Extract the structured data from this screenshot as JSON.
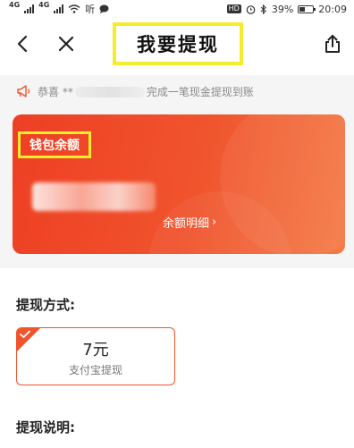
{
  "status_bar": {
    "network_left": "4G",
    "network_mid": "4G",
    "speech_label": "听",
    "hd_badge": "HD",
    "battery_percent": "39%",
    "time": "20:09"
  },
  "nav": {
    "title": "我要提现"
  },
  "notice": {
    "prefix": "恭喜 **",
    "masked_account": "1  27  7 0",
    "suffix": " 完成一笔现金提现到账"
  },
  "wallet": {
    "label": "钱包余额",
    "detail_link": "余额明细",
    "detail_arrow": "›"
  },
  "withdraw_method": {
    "title": "提现方式:",
    "options": [
      {
        "amount": "7元",
        "name": "支付宝提现",
        "selected": true
      }
    ]
  },
  "withdraw_desc": {
    "title": "提现说明:"
  },
  "colors": {
    "accent": "#f0542d",
    "highlight_box": "#f5ec2f",
    "notice_bg": "#f5f5f5"
  }
}
